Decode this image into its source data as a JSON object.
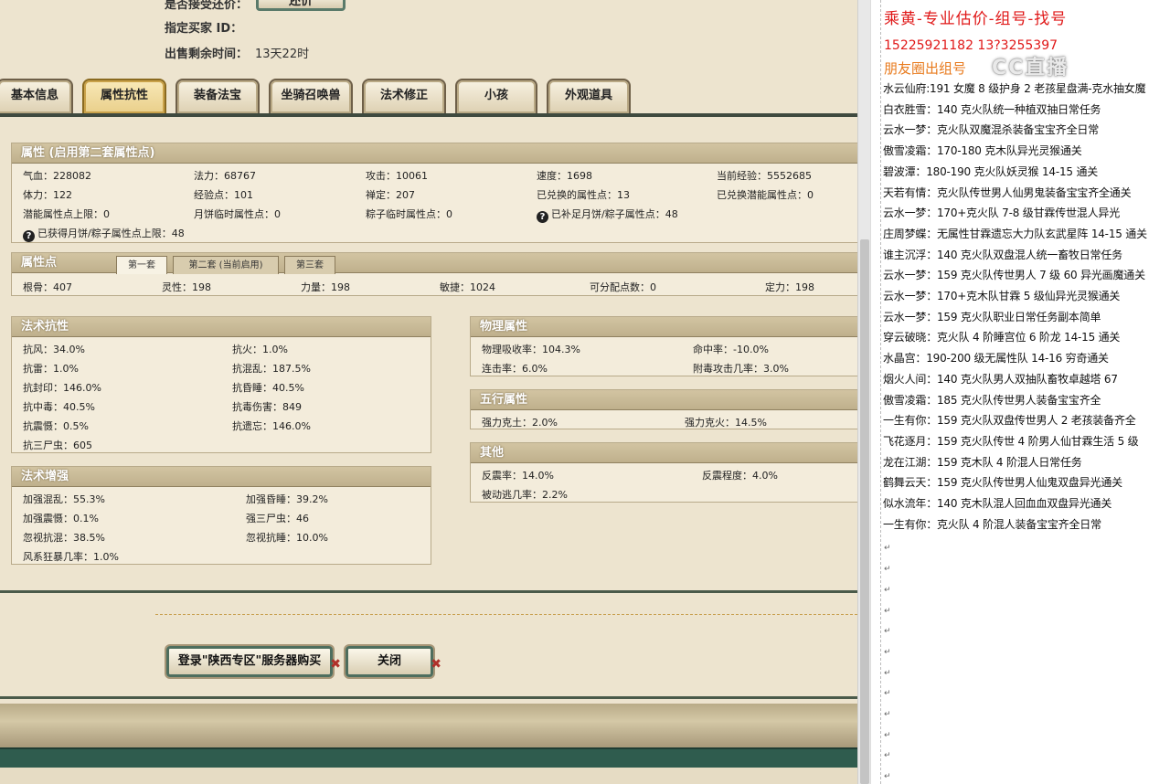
{
  "top_info": {
    "partial_label": "是否接受还价：",
    "partial_button": "还价",
    "buyer_label": "指定买家 ID：",
    "buyer_value": "",
    "time_label": "出售剩余时间：",
    "time_value": "13天22时"
  },
  "tabs": [
    "基本信息",
    "属性抗性",
    "装备法宝",
    "坐骑召唤兽",
    "法术修正",
    "小孩",
    "外观道具"
  ],
  "active_tab": "属性抗性",
  "attributes": {
    "title": "属性 (启用第二套属性点)",
    "rows": [
      [
        "气血：228082",
        "法力：68767",
        "攻击：10061",
        "速度：1698",
        "当前经验：5552685"
      ],
      [
        "体力：122",
        "经验点：101",
        "禅定：207",
        "已兑换的属性点：13",
        "已兑换潜能属性点：0"
      ],
      [
        "潜能属性点上限：0",
        "月饼临时属性点：0",
        "粽子临时属性点：0",
        "已补足月饼/粽子属性点：48",
        ""
      ]
    ],
    "extra": "已获得月饼/粽子属性点上限：48"
  },
  "points": {
    "title": "属性点",
    "subtabs": [
      "第一套",
      "第二套 (当前启用)",
      "第三套"
    ],
    "values": [
      "根骨：407",
      "灵性：198",
      "力量：198",
      "敏捷：1024",
      "可分配点数：0",
      "定力：198"
    ]
  },
  "magic_resist": {
    "title": "法术抗性",
    "rows": [
      [
        "抗风：34.0%",
        "抗火：1.0%"
      ],
      [
        "抗雷：1.0%",
        "抗混乱：187.5%"
      ],
      [
        "抗封印：146.0%",
        "抗昏睡：40.5%"
      ],
      [
        "抗中毒：40.5%",
        "抗毒伤害：849"
      ],
      [
        "抗震慑：0.5%",
        "抗遗忘：146.0%"
      ],
      [
        "抗三尸虫：605",
        ""
      ]
    ]
  },
  "magic_boost": {
    "title": "法术增强",
    "rows": [
      [
        "加强混乱：55.3%",
        "加强昏睡：39.2%"
      ],
      [
        "加强震慑：0.1%",
        "强三尸虫：46"
      ],
      [
        "忽视抗混：38.5%",
        "忽视抗睡：10.0%"
      ],
      [
        "风系狂暴几率：1.0%",
        ""
      ]
    ]
  },
  "physical": {
    "title": "物理属性",
    "rows": [
      [
        "物理吸收率：104.3%",
        "命中率：-10.0%"
      ],
      [
        "连击率：6.0%",
        "附毒攻击几率：3.0%"
      ]
    ]
  },
  "elements": {
    "title": "五行属性",
    "rows": [
      [
        "强力克土：2.0%",
        "强力克火：14.5%"
      ]
    ]
  },
  "other": {
    "title": "其他",
    "rows": [
      [
        "反震率：14.0%",
        "反震程度：4.0%"
      ],
      [
        "被动逃几率：2.2%",
        ""
      ]
    ]
  },
  "buttons": {
    "buy": "登录\"陕西专区\"服务器购买",
    "close": "关闭"
  },
  "doc": {
    "title": "乘黄-专业估价-组号-找号",
    "phone": "15225921182    13?3255397",
    "sub": "朋友圈出组号",
    "watermark": "CC直播",
    "lines": [
      "水云仙府:191 女魔 8 级护身 2 老孩星盘满-克水抽女魔",
      "白衣胜雪：140 克火队统一种植双抽日常任务",
      "云水一梦：克火队双魔混杀装备宝宝齐全日常",
      "傲雪凌霜：170-180 克木队异光灵猴通关",
      "碧波潭：180-190 克火队妖灵猴 14-15 通关",
      "天若有情：克火队传世男人仙男鬼装备宝宝齐全通关",
      "云水一梦：170+克火队 7-8 级甘霖传世混人异光",
      "庄周梦蝶：无属性甘霖遗忘大力队玄武星阵 14-15 通关",
      "谁主沉浮：140 克火队双盘混人统一畜牧日常任务",
      "云水一梦：159 克火队传世男人 7 级 60 异光画魔通关",
      "云水一梦：170+克木队甘霖 5 级仙异光灵猴通关",
      "云水一梦：159 克火队职业日常任务副本简单",
      "穿云破晓：克火队 4 阶睡宫位 6 阶龙 14-15 通关",
      "水晶宫：190-200 级无属性队 14-16 穷奇通关",
      "烟火人间：140 克火队男人双抽队畜牧卓越塔 67",
      "傲雪凌霜：185 克火队传世男人装备宝宝齐全",
      "一生有你：159 克火队双盘传世男人 2 老孩装备齐全",
      "飞花逐月：159 克火队传世 4 阶男人仙甘霖生活 5 级",
      "龙在江湖：159 克木队 4 阶混人日常任务",
      "鹤舞云天：159 克火队传世男人仙鬼双盘异光通关",
      "似水流年：140 克木队混人回血血双盘异光通关",
      "一生有你：克火队 4 阶混人装备宝宝齐全日常"
    ]
  }
}
